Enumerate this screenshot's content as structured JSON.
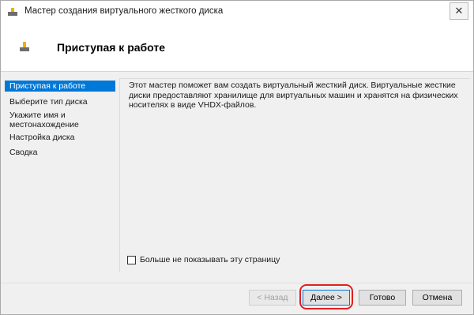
{
  "window": {
    "title": "Мастер создания виртуального жесткого диска",
    "close_glyph": "✕"
  },
  "header": {
    "title": "Приступая к работе",
    "icon": "disk-icon"
  },
  "sidebar": {
    "items": [
      {
        "label": "Приступая к работе",
        "active": true
      },
      {
        "label": "Выберите тип диска",
        "active": false
      },
      {
        "label_line1": "Укажите имя и",
        "label_line2": "местонахождение",
        "active": false
      },
      {
        "label": "Настройка диска",
        "active": false
      },
      {
        "label": "Сводка",
        "active": false
      }
    ]
  },
  "main": {
    "description": "Этот мастер поможет вам создать виртуальный жесткий диск. Виртуальные жесткие диски предоставляют хранилище для виртуальных машин и хранятся на физических носителях в виде VHDX-файлов.",
    "dont_show_label": "Больше не показывать эту страницу"
  },
  "buttons": {
    "back": "< Назад",
    "next": "Далее >",
    "finish": "Готово",
    "cancel": "Отмена"
  },
  "colors": {
    "accent": "#0078d7",
    "highlight": "#e02020"
  }
}
